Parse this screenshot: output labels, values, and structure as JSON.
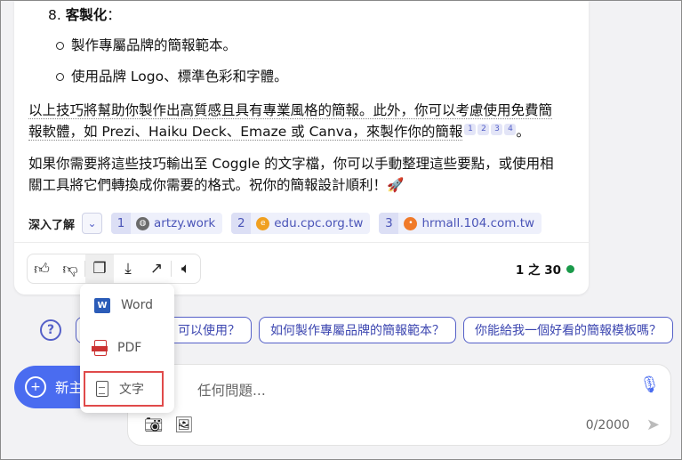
{
  "answer": {
    "item8_prefix": "8. ",
    "item8_title": "客製化",
    "item8_colon": "：",
    "bullets": [
      "製作專屬品牌的簡報範本。",
      "使用品牌 Logo、標準色彩和字體。"
    ],
    "para1_line1": "以上技巧將幫助你製作出高質感且具有專業風格的簡報。此外，你可以考慮使用免費簡",
    "para1_line2": "報軟體，如 Prezi、Haiku Deck、Emaze 或 Canva，來製作你的簡報",
    "para1_end": "。",
    "citations": [
      "1",
      "2",
      "3",
      "4"
    ],
    "para2_line1": "如果你需要將這些技巧輸出至 Coggle 的文字檔，你可以手動整理這些要點，或使用相",
    "para2_line2": "關工具將它們轉換成你需要的格式。祝你的簡報設計順利！🚀"
  },
  "deeper": {
    "label": "深入了解",
    "sources": [
      {
        "num": "1",
        "site": "artzy.work",
        "icon": "globe-icon"
      },
      {
        "num": "2",
        "site": "edu.cpc.org.tw",
        "icon": "cpc-logo-icon"
      },
      {
        "num": "3",
        "site": "hrmall.104.com.tw",
        "icon": "104-logo-icon"
      }
    ]
  },
  "actions": {
    "pager": "1 之 30",
    "status_color": "#1a9a4a"
  },
  "export_menu": {
    "items": [
      "Word",
      "PDF",
      "文字"
    ]
  },
  "suggestions": [
    "可以使用？",
    "如何製作專屬品牌的簡報範本？",
    "你能給我一個好看的簡報模板嗎？"
  ],
  "new_topic": {
    "label": "新主"
  },
  "composer": {
    "placeholder": "任何問題...",
    "counter": "0/2000"
  },
  "colors": {
    "accent": "#4a6cf0",
    "chip_text": "#4b55b8",
    "highlight_border": "#e04a4a"
  }
}
